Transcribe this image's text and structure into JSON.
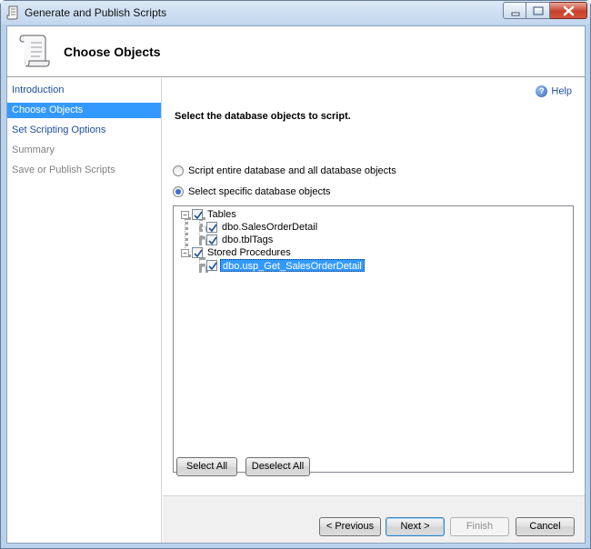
{
  "window": {
    "title": "Generate and Publish Scripts"
  },
  "header": {
    "title": "Choose Objects"
  },
  "nav": {
    "items": [
      {
        "label": "Introduction",
        "state": "link"
      },
      {
        "label": "Choose Objects",
        "state": "selected"
      },
      {
        "label": "Set Scripting Options",
        "state": "link"
      },
      {
        "label": "Summary",
        "state": "disabled"
      },
      {
        "label": "Save or Publish Scripts",
        "state": "disabled"
      }
    ]
  },
  "main": {
    "help_label": "Help",
    "section_title": "Select the database objects to script.",
    "radio_entire": "Script entire database and all database objects",
    "radio_specific": "Select specific database objects",
    "selected_radio": "specific"
  },
  "tree": {
    "tables_label": "Tables",
    "tables_items": [
      "dbo.SalesOrderDetail",
      "dbo.tblTags"
    ],
    "procs_label": "Stored Procedures",
    "procs_items": [
      "dbo.usp_Get_SalesOrderDetail"
    ],
    "selected_item": "dbo.usp_Get_SalesOrderDetail"
  },
  "buttons": {
    "select_all": "Select All",
    "deselect_all": "Deselect All",
    "previous": "< Previous",
    "next": "Next >",
    "finish": "Finish",
    "cancel": "Cancel"
  },
  "colors": {
    "selection": "#3399ff",
    "link": "#1c4ea0",
    "title_bar": "#c2d6ee"
  }
}
